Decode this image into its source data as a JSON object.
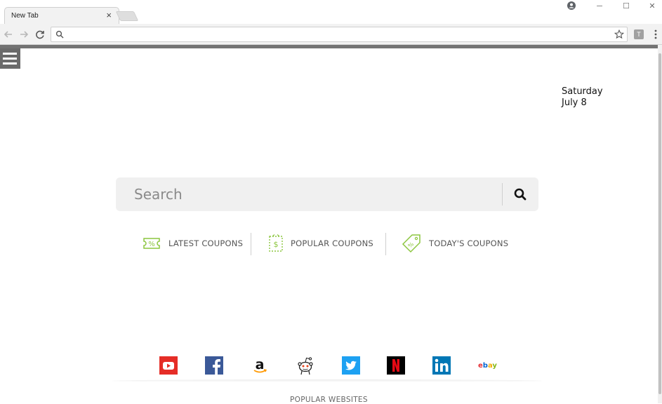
{
  "browser": {
    "tab_title": "New Tab",
    "tab_close": "×",
    "window_controls": {
      "minimize": "─",
      "maximize": "☐",
      "close": "✕"
    },
    "address_value": "",
    "extension_label": "T"
  },
  "page": {
    "date": {
      "weekday": "Saturday",
      "month_day": "July 8"
    },
    "search": {
      "placeholder": "Search",
      "value": ""
    },
    "coupons": [
      {
        "label": "LATEST COUPONS",
        "icon": "percent-ticket-icon"
      },
      {
        "label": "POPULAR COUPONS",
        "icon": "dollar-coupon-icon"
      },
      {
        "label": "TODAY'S COUPONS",
        "icon": "tag-coupon-icon"
      }
    ],
    "popular_sites": [
      {
        "name": "youtube",
        "icon": "youtube-icon"
      },
      {
        "name": "facebook",
        "icon": "facebook-icon"
      },
      {
        "name": "amazon",
        "icon": "amazon-icon"
      },
      {
        "name": "reddit",
        "icon": "reddit-icon"
      },
      {
        "name": "twitter",
        "icon": "twitter-icon"
      },
      {
        "name": "netflix",
        "icon": "netflix-icon"
      },
      {
        "name": "linkedin",
        "icon": "linkedin-icon"
      },
      {
        "name": "ebay",
        "icon": "ebay-icon",
        "text": "ebay"
      }
    ],
    "popular_label": "POPULAR WEBSITES"
  },
  "colors": {
    "coupon_green": "#8cc63f",
    "youtube": "#e52d27",
    "facebook": "#3b5998",
    "twitter": "#1da1f2",
    "netflix": "#e50914",
    "linkedin": "#0077b5",
    "hamburger_bg": "#6a6a6a"
  }
}
